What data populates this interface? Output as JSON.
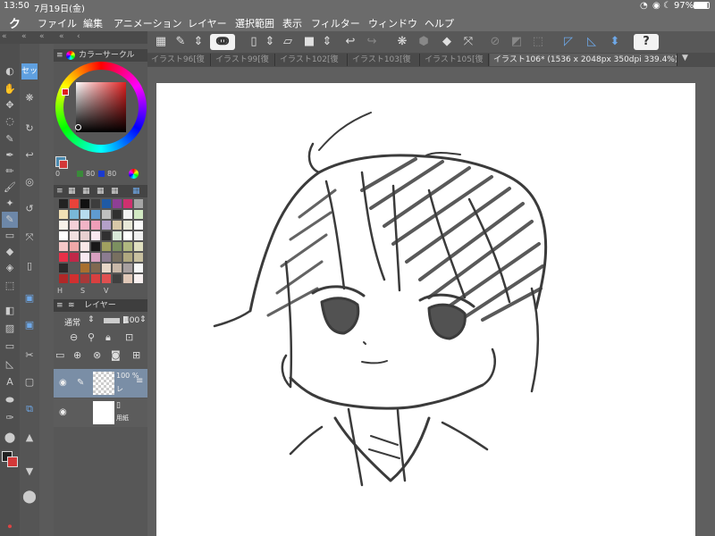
{
  "status_bar": {
    "time": "13:50",
    "date": "7月19日(金)",
    "battery": "97%"
  },
  "menu": {
    "logo": "ク",
    "items": [
      "ファイル",
      "編集",
      "アニメーション",
      "レイヤー",
      "選択範囲",
      "表示",
      "フィルター",
      "ウィンドウ",
      "ヘルプ"
    ]
  },
  "tabs": [
    {
      "label": "イラスト96[復",
      "active": false
    },
    {
      "label": "イラスト99[復",
      "active": false
    },
    {
      "label": "イラスト102[復",
      "active": false
    },
    {
      "label": "イラスト103[復",
      "active": false
    },
    {
      "label": "イラスト105[復",
      "active": false
    },
    {
      "label": "イラスト106* (1536 x 2048px 350dpi 339.4%)",
      "active": true
    }
  ],
  "color_panel": {
    "title": "カラーサークル",
    "main_color": "#d33838",
    "values": [
      "0",
      "80",
      "80"
    ]
  },
  "subtool_label": "セッ",
  "palette_colors": [
    "#222222",
    "#e8433a",
    "#111111",
    "#3d3d3d",
    "#1f5aa5",
    "#8e3f95",
    "#d0306f",
    "#a6a6a6",
    "#f2e0b5",
    "#79b8d7",
    "#b7dcee",
    "#5f9bd1",
    "#c0c0c0",
    "#303030",
    "#f2f2f2",
    "#d2e9c3",
    "#f8f2ea",
    "#f4d0d8",
    "#f1b4c6",
    "#ee9eb8",
    "#b3a0c8",
    "#d8c8a8",
    "#e8e8d8",
    "#fafafa",
    "#ffffff",
    "#f0e0e0",
    "#e8d0d0",
    "#f8e8f0",
    "#303030",
    "#d8e8d8",
    "#ffffff",
    "#f0f0f0",
    "#f5c8c8",
    "#f0a8a8",
    "#fae8e8",
    "#181818",
    "#a0a060",
    "#7c9060",
    "#b0b880",
    "#e0e0c0",
    "#e83048",
    "#c02848",
    "#f8e8f0",
    "#d8a0c0",
    "#8c7c90",
    "#787060",
    "#b0a880",
    "#c8c0a0",
    "#2a2a2a",
    "#585858",
    "#a87030",
    "#806850",
    "#e8d8c8",
    "#c8b8a8",
    "#a8a0a0",
    "#f8f8f8",
    "#b02828",
    "#d03030",
    "#a83838",
    "#d84040",
    "#e05050",
    "#404040",
    "#e0c8b8",
    "#f8f0f0"
  ],
  "palette_footer": [
    "H",
    "S",
    "V"
  ],
  "layer_panel": {
    "title": "レイヤー",
    "blend_mode": "通常",
    "opacity": "100",
    "layers": [
      {
        "opacity": "100 %",
        "name": "レ"
      },
      {
        "opacity": "",
        "name": "用紙"
      }
    ]
  }
}
